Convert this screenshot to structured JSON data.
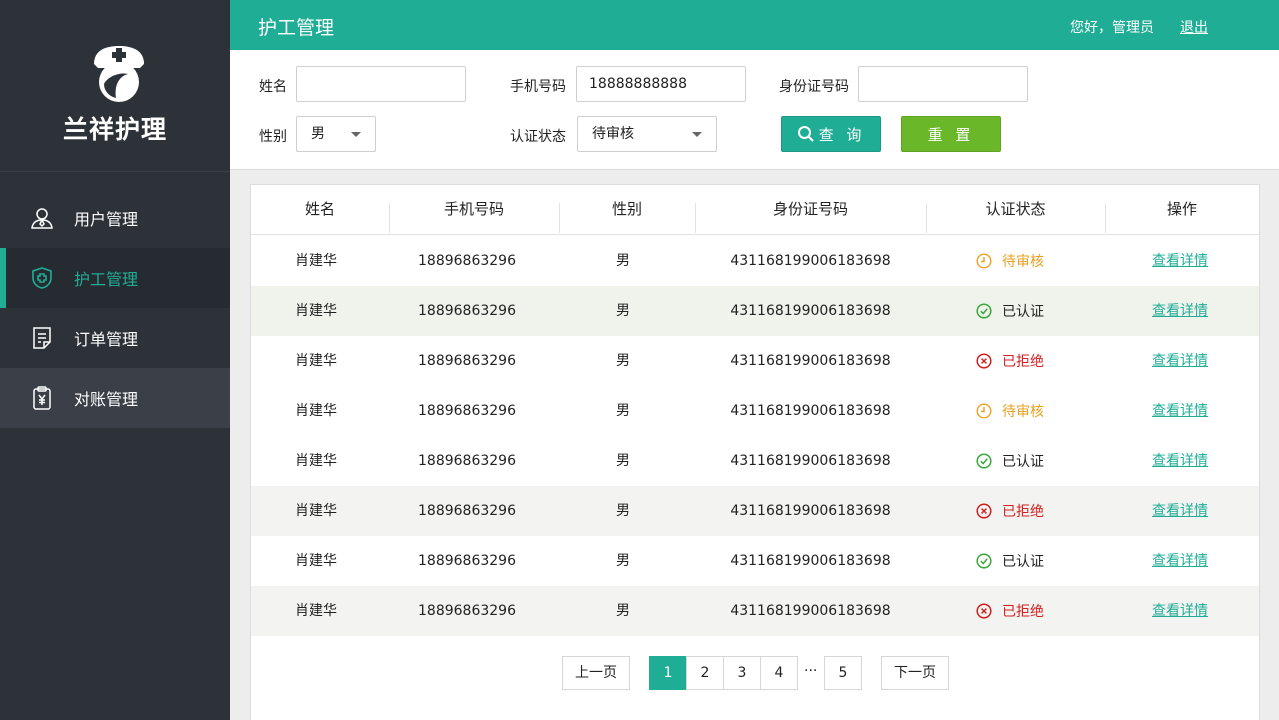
{
  "brand": {
    "name": "兰祥护理"
  },
  "sidebar": {
    "items": [
      {
        "label": "用户管理",
        "icon": "user-icon"
      },
      {
        "label": "护工管理",
        "icon": "shield-plus-icon"
      },
      {
        "label": "订单管理",
        "icon": "document-icon"
      },
      {
        "label": "对账管理",
        "icon": "clipboard-yen-icon"
      }
    ]
  },
  "topbar": {
    "title": "护工管理",
    "greeting": "您好，管理员",
    "logout": "退出"
  },
  "filter": {
    "name_label": "姓名",
    "name_value": "",
    "phone_label": "手机号码",
    "phone_value": "18888888888",
    "id_label": "身份证号码",
    "id_value": "",
    "gender_label": "性别",
    "gender_value": "男",
    "status_label": "认证状态",
    "status_value": "待审核",
    "query_label": "查 询",
    "reset_label": "重 置"
  },
  "table": {
    "headers": [
      "姓名",
      "手机号码",
      "性别",
      "身份证号码",
      "认证状态",
      "操作"
    ],
    "action_label": "查看详情",
    "rows": [
      {
        "name": "肖建华",
        "phone": "18896863296",
        "gender": "男",
        "id": "431168199006183698",
        "status": "待审核",
        "status_type": "pending"
      },
      {
        "name": "肖建华",
        "phone": "18896863296",
        "gender": "男",
        "id": "431168199006183698",
        "status": "已认证",
        "status_type": "verified"
      },
      {
        "name": "肖建华",
        "phone": "18896863296",
        "gender": "男",
        "id": "431168199006183698",
        "status": "已拒绝",
        "status_type": "rejected"
      },
      {
        "name": "肖建华",
        "phone": "18896863296",
        "gender": "男",
        "id": "431168199006183698",
        "status": "待审核",
        "status_type": "pending"
      },
      {
        "name": "肖建华",
        "phone": "18896863296",
        "gender": "男",
        "id": "431168199006183698",
        "status": "已认证",
        "status_type": "verified"
      },
      {
        "name": "肖建华",
        "phone": "18896863296",
        "gender": "男",
        "id": "431168199006183698",
        "status": "已拒绝",
        "status_type": "rejected"
      },
      {
        "name": "肖建华",
        "phone": "18896863296",
        "gender": "男",
        "id": "431168199006183698",
        "status": "已认证",
        "status_type": "verified"
      },
      {
        "name": "肖建华",
        "phone": "18896863296",
        "gender": "男",
        "id": "431168199006183698",
        "status": "已拒绝",
        "status_type": "rejected"
      }
    ]
  },
  "pagination": {
    "prev": "上一页",
    "next": "下一页",
    "pages": [
      "1",
      "2",
      "3",
      "4"
    ],
    "ellipsis": "···",
    "last": "5",
    "current": "1"
  },
  "colors": {
    "accent": "#20ad96",
    "sidebar_bg": "#2d3239",
    "pending": "#e8a020",
    "verified": "#3aa83a",
    "rejected": "#d02020",
    "reset_btn": "#6ab72a"
  }
}
